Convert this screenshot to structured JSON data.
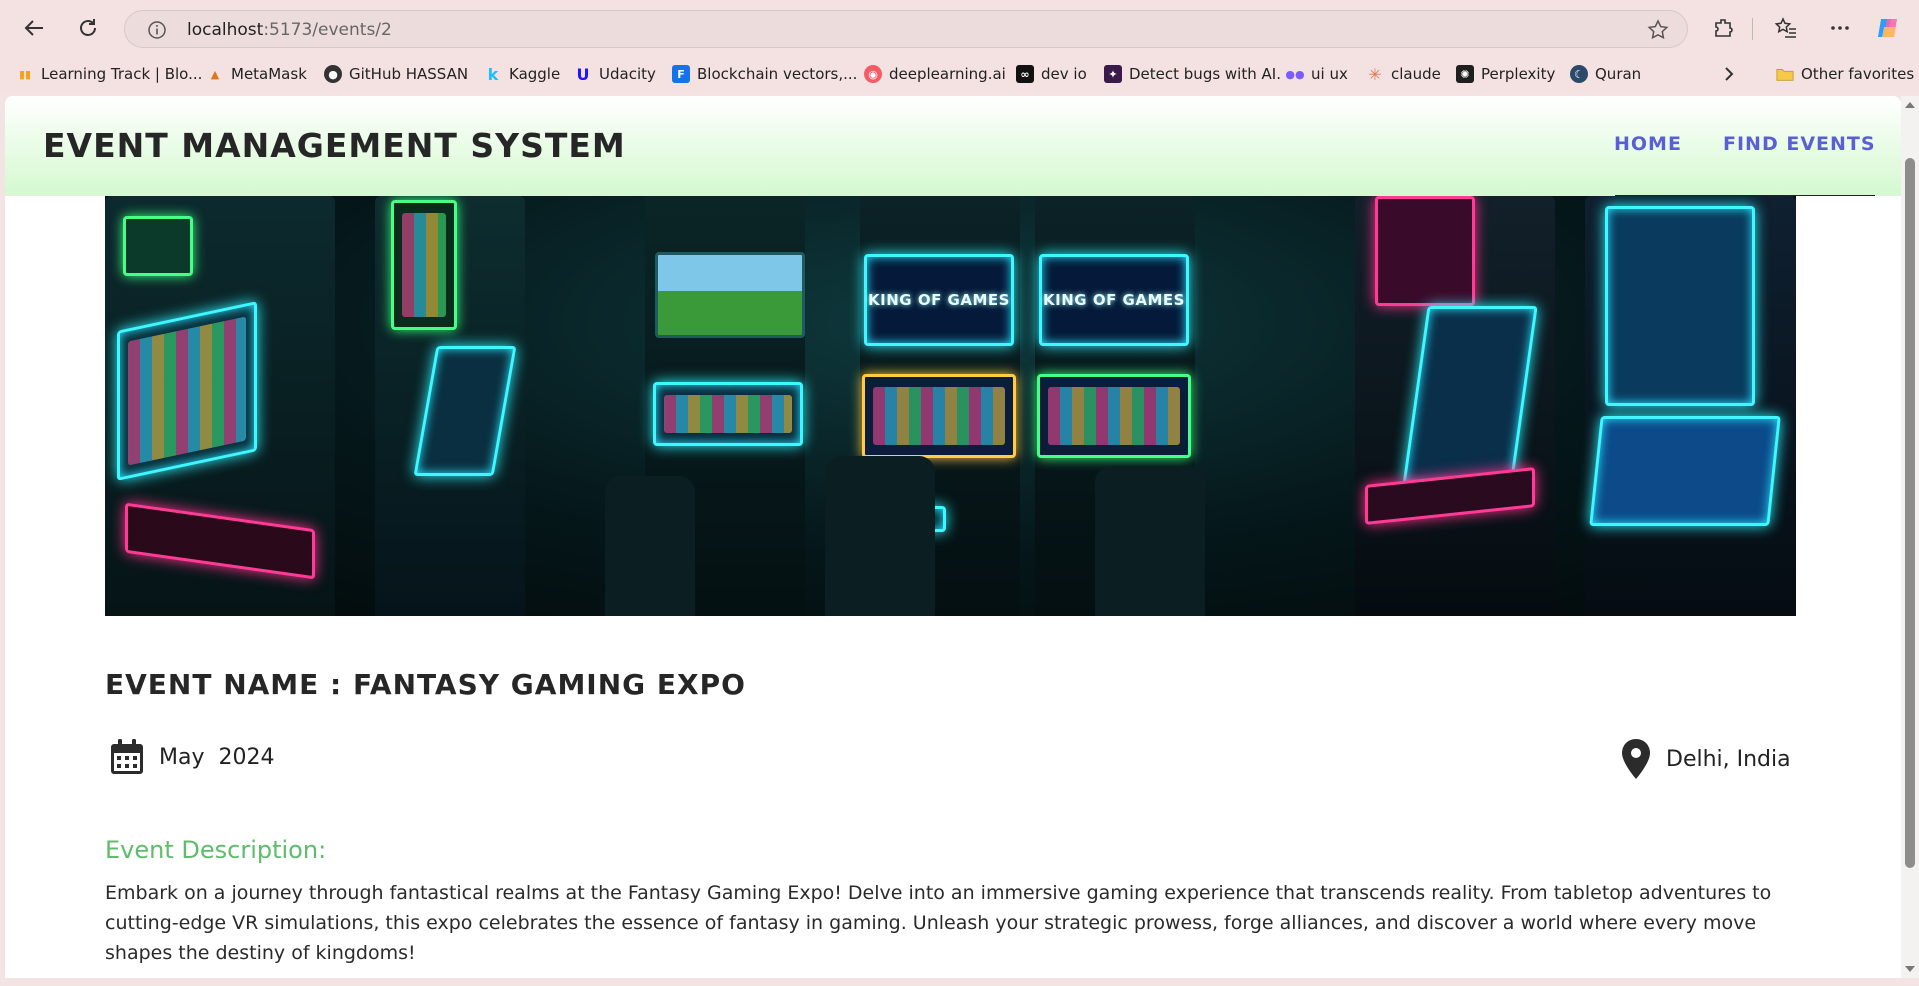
{
  "browser": {
    "url_host": "localhost",
    "url_path": ":5173/events/2",
    "bookmarks": [
      {
        "label": "Learning Track | Blo...",
        "icon": "bar-chart-icon",
        "color": "#f2a51a"
      },
      {
        "label": "MetaMask",
        "icon": "fox-icon",
        "color": "#e2761b"
      },
      {
        "label": "GitHub HASSAN",
        "icon": "github-icon",
        "color": "#333333"
      },
      {
        "label": "Kaggle",
        "icon": "kaggle-icon",
        "color": "#20beff"
      },
      {
        "label": "Udacity",
        "icon": "udacity-icon",
        "color": "#2015ff"
      },
      {
        "label": "Blockchain vectors,...",
        "icon": "freepik-icon",
        "color": "#1273eb"
      },
      {
        "label": "deeplearning.ai",
        "icon": "deeplearning-icon",
        "color": "#f65b66"
      },
      {
        "label": "dev io",
        "icon": "devio-icon",
        "color": "#111111"
      },
      {
        "label": "Detect bugs with AI.",
        "icon": "bug-shield-icon",
        "color": "#3a1a4a"
      },
      {
        "label": "ui ux",
        "icon": "uiux-icon",
        "color": "#7a5cff"
      },
      {
        "label": "claude",
        "icon": "claude-icon",
        "color": "#d97757"
      },
      {
        "label": "Perplexity",
        "icon": "perplexity-icon",
        "color": "#1f1f1f"
      },
      {
        "label": "Quran",
        "icon": "quran-icon",
        "color": "#2b4a6a"
      }
    ],
    "other_favorites": "Other favorites"
  },
  "header": {
    "title": "EVENT MANAGEMENT SYSTEM",
    "nav": [
      "HOME",
      "FIND EVENTS"
    ]
  },
  "hero": {
    "screen_text_1": "KING OF GAMES",
    "screen_text_2": "KING OF GAMES"
  },
  "event": {
    "title": "EVENT NAME : FANTASY GAMING EXPO",
    "month": "May",
    "year": "2024",
    "location": "Delhi, India",
    "description_heading": "Event Description:",
    "description": "Embark on a journey through fantastical realms at the Fantasy Gaming Expo! Delve into an immersive gaming experience that transcends reality. From tabletop adventures to cutting-edge VR simulations, this expo celebrates the essence of fantasy in gaming. Unleash your strategic prowess, forge alliances, and discover a world where every move shapes the destiny of kingdoms!"
  },
  "colors": {
    "nav_link": "#5b5fd6",
    "description_heading": "#5fbc6a",
    "header_gradient_end": "#d4f9cf"
  }
}
